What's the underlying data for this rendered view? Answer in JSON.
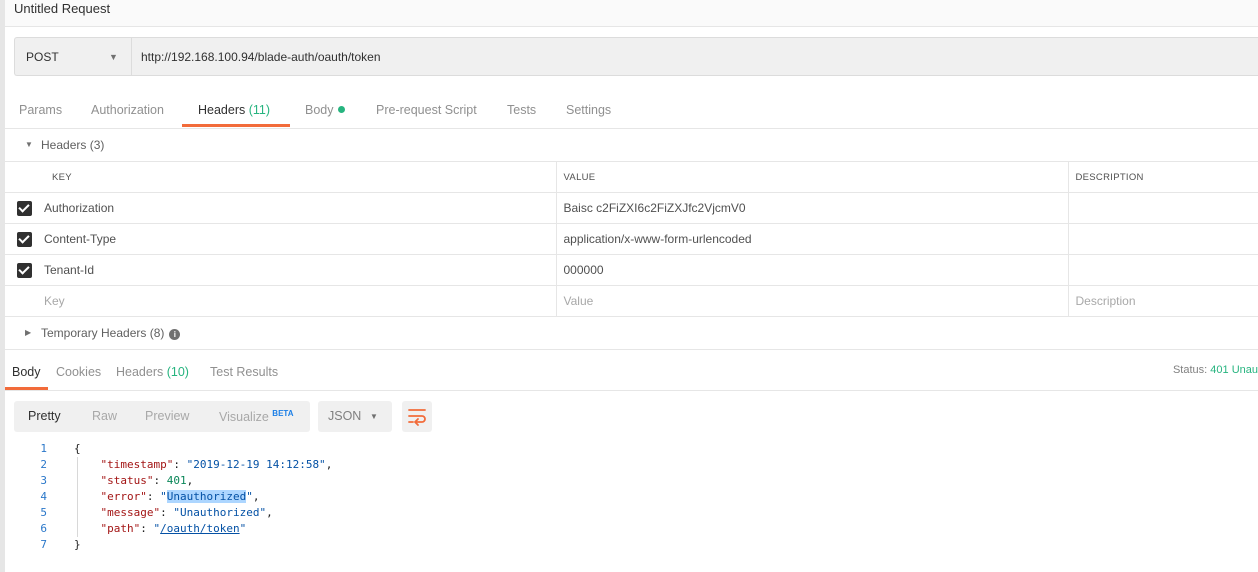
{
  "request": {
    "title": "Untitled Request",
    "method": "POST",
    "url": "http://192.168.100.94/blade-auth/oauth/token"
  },
  "request_tabs": [
    {
      "label": "Params"
    },
    {
      "label": "Authorization"
    },
    {
      "label": "Headers",
      "count": "(11)"
    },
    {
      "label": "Body"
    },
    {
      "label": "Pre-request Script"
    },
    {
      "label": "Tests"
    },
    {
      "label": "Settings"
    }
  ],
  "headers_section": {
    "label": "Headers (3)",
    "columns": {
      "key": "KEY",
      "value": "VALUE",
      "description": "DESCRIPTION"
    },
    "rows": [
      {
        "key": "Authorization",
        "value": "Baisc c2FiZXI6c2FiZXJfc2VjcmV0",
        "description": ""
      },
      {
        "key": "Content-Type",
        "value": "application/x-www-form-urlencoded",
        "description": ""
      },
      {
        "key": "Tenant-Id",
        "value": "000000",
        "description": ""
      }
    ],
    "placeholder": {
      "key": "Key",
      "value": "Value",
      "description": "Description"
    }
  },
  "temporary_headers": {
    "label": "Temporary Headers (8)"
  },
  "response_tabs": [
    {
      "label": "Body"
    },
    {
      "label": "Cookies"
    },
    {
      "label": "Headers",
      "count": "(10)"
    },
    {
      "label": "Test Results"
    }
  ],
  "status": {
    "label": "Status:",
    "value": "401 Unau"
  },
  "view_modes": {
    "pretty": "Pretty",
    "raw": "Raw",
    "preview": "Preview",
    "visualize": "Visualize",
    "beta": "BETA"
  },
  "format": "JSON",
  "body_code": {
    "open": "{",
    "close": "}",
    "entries": [
      {
        "key": "\"timestamp\"",
        "value": "\"2019-12-19 14:12:58\""
      },
      {
        "key": "\"status\"",
        "value": "401"
      },
      {
        "key": "\"error\"",
        "value": "Unauthorized"
      },
      {
        "key": "\"message\"",
        "value": "\"Unauthorized\""
      },
      {
        "key": "\"path\"",
        "value": "/oauth/token"
      }
    ]
  },
  "icons": {
    "method_caret": "chevron-down-icon",
    "wrap": "wrap-lines-icon",
    "info": "info-icon"
  },
  "colors": {
    "accent": "#f26b3a",
    "green": "#26b47f",
    "link_blue": "#1a7ee6"
  }
}
